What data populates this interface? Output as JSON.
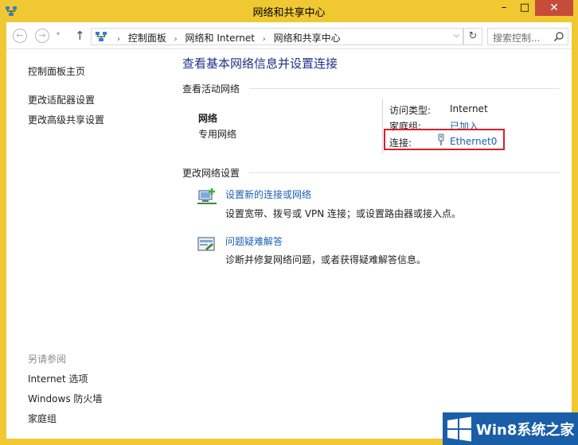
{
  "window": {
    "title": "网络和共享中心",
    "minimize_label": "–",
    "maximize_label": "□",
    "close_label": "✕"
  },
  "nav": {
    "back_label": "←",
    "forward_label": "→",
    "recent_label": "▾",
    "up_label": "↑",
    "breadcrumbs": [
      "控制面板",
      "网络和 Internet",
      "网络和共享中心"
    ],
    "breadcrumb_sep": "›",
    "dropdown_label": "⌵",
    "refresh_label": "↻",
    "search_placeholder": "搜索控制..."
  },
  "sidebar": {
    "links": [
      "控制面板主页",
      "更改适配器设置",
      "更改高级共享设置"
    ],
    "see_also_heading": "另请参阅",
    "see_also": [
      "Internet 选项",
      "Windows 防火墙",
      "家庭组"
    ]
  },
  "main": {
    "title": "查看基本网络信息并设置连接",
    "active_heading": "查看活动网络",
    "network_name": "网络",
    "network_type": "专用网络",
    "access_type_label": "访问类型:",
    "access_type_value": "Internet",
    "homegroup_label": "家庭组:",
    "homegroup_value": "已加入",
    "connection_label": "连接:",
    "connection_value": "Ethernet0",
    "change_heading": "更改网络设置",
    "tasks": [
      {
        "title": "设置新的连接或网络",
        "desc": "设置宽带、拨号或 VPN 连接；或设置路由器或接入点。"
      },
      {
        "title": "问题疑难解答",
        "desc": "诊断并修复网络问题，或者获得疑难解答信息。"
      }
    ]
  },
  "watermark": {
    "text": "Win8系统之家"
  },
  "colors": {
    "frame": "#f0c832",
    "close_button": "#c74b3b",
    "link": "#1a5fb4",
    "title_text": "#1e3287",
    "highlight_box": "#d6202a",
    "watermark_bg": "#1b5ea8"
  }
}
